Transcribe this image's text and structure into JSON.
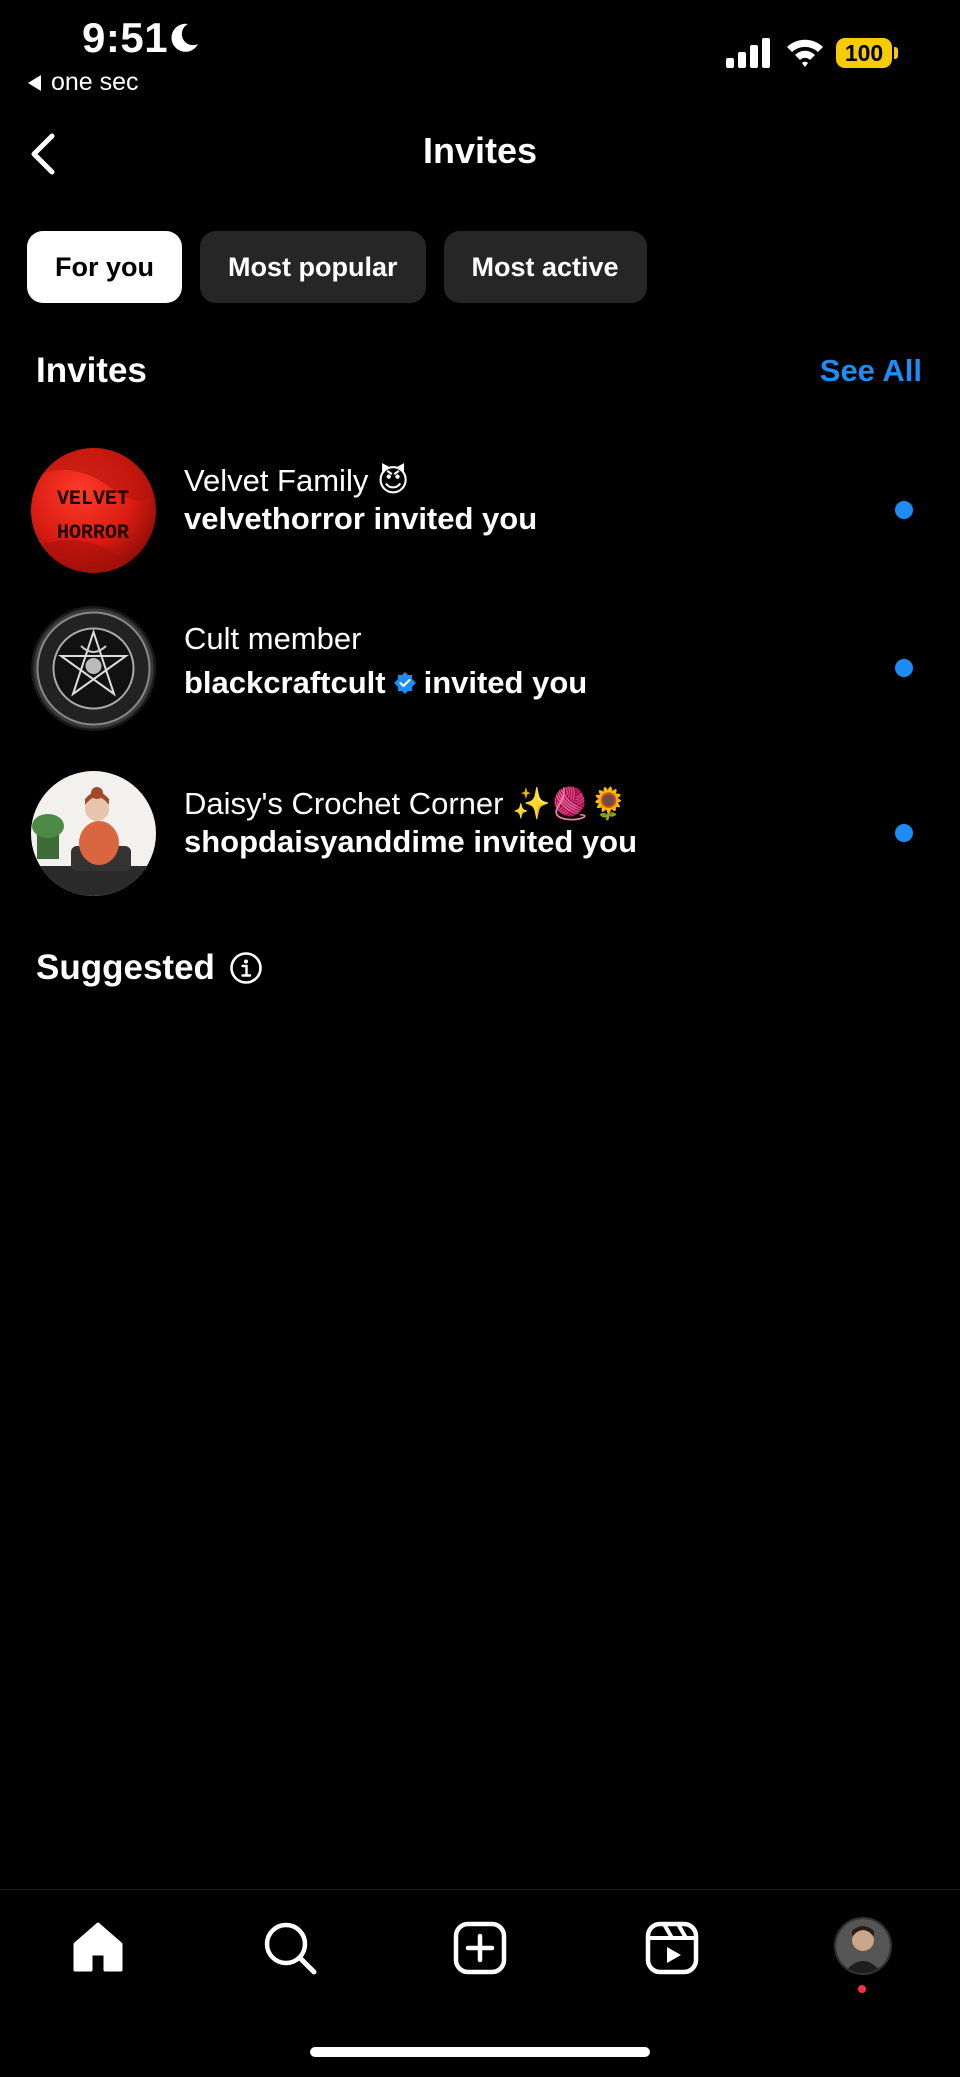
{
  "status_bar": {
    "time": "9:51",
    "back_app_label": "one sec",
    "battery": "100"
  },
  "header": {
    "title": "Invites"
  },
  "tabs": [
    {
      "label": "For you",
      "active": true
    },
    {
      "label": "Most popular",
      "active": false
    },
    {
      "label": "Most active",
      "active": false
    }
  ],
  "invites_section": {
    "title": "Invites",
    "see_all": "See All",
    "items": [
      {
        "channel_name": "Velvet Family 😈",
        "inviter": "velvethorror",
        "suffix": "invited you",
        "verified": false,
        "avatar_text_line1": "VELVET",
        "avatar_text_line2": "HORROR"
      },
      {
        "channel_name": "Cult member",
        "inviter": "blackcraftcult",
        "suffix": "invited you",
        "verified": true
      },
      {
        "channel_name": "Daisy's Crochet Corner ✨🧶🌻",
        "inviter": "shopdaisyanddime",
        "suffix": "invited you",
        "verified": false
      }
    ]
  },
  "suggested": {
    "title": "Suggested"
  },
  "colors": {
    "accent": "#1d8cf5",
    "background": "#000000",
    "tab_inactive": "#262626",
    "notification": "#ff3040"
  },
  "bottom_nav": {
    "icons": [
      "home-icon",
      "search-icon",
      "create-icon",
      "reels-icon",
      "profile-avatar"
    ]
  }
}
